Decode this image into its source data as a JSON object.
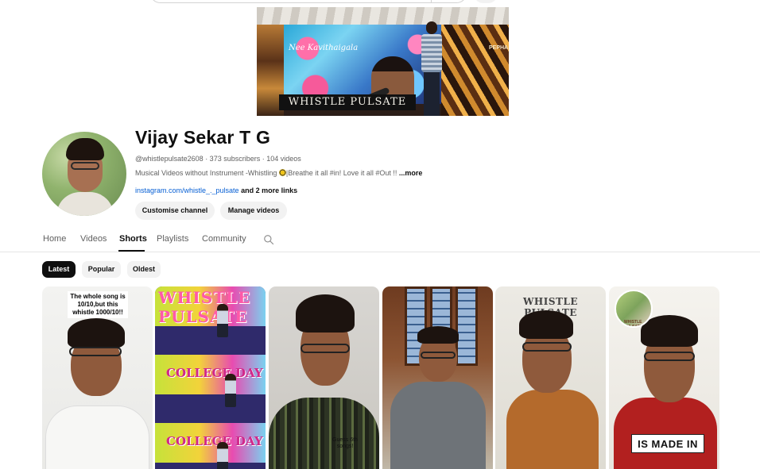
{
  "banner": {
    "title": "WHISTLE PULSATE",
    "script_text": "Nee Kavithaigala",
    "corner_tag": "PEPHA"
  },
  "channel": {
    "name": "Vijay Sekar T G",
    "meta": "@whistlepulsate2608 · 373 subscribers · 104 videos",
    "description": "Musical Videos without Instrument -Whistling",
    "description_tail": "|Breathe it all #in! Love it all #Out !! ",
    "more_label": "...more",
    "link_text": "instagram.com/whistle_._pulsate",
    "more_links": " and 2 more links"
  },
  "buttons": {
    "customise": "Customise channel",
    "manage": "Manage videos"
  },
  "tabs": [
    {
      "label": "Home",
      "active": false
    },
    {
      "label": "Videos",
      "active": false
    },
    {
      "label": "Shorts",
      "active": true
    },
    {
      "label": "Playlists",
      "active": false
    },
    {
      "label": "Community",
      "active": false
    }
  ],
  "chips": [
    {
      "label": "Latest",
      "active": true
    },
    {
      "label": "Popular",
      "active": false
    },
    {
      "label": "Oldest",
      "active": false
    }
  ],
  "shorts": [
    {
      "overlay_text": "The whole song is 10/10,but this whistle 1000/10!!"
    },
    {
      "overlay_text": "WHISTLE PULSATE",
      "sub_text": "COLLEGE DAY"
    },
    {
      "overlay_text": "Guess 6th songs!"
    },
    {
      "overlay_text": ""
    },
    {
      "overlay_text": "WHISTLE PULSATE"
    },
    {
      "overlay_text": "IS MADE IN",
      "badge_text": "WHISTLE PULSATE"
    }
  ],
  "colors": {
    "text_primary": "#0f0f0f",
    "text_secondary": "#606060",
    "link": "#065fd4",
    "chip_bg": "#f2f2f2",
    "chip_active_bg": "#0f0f0f"
  }
}
